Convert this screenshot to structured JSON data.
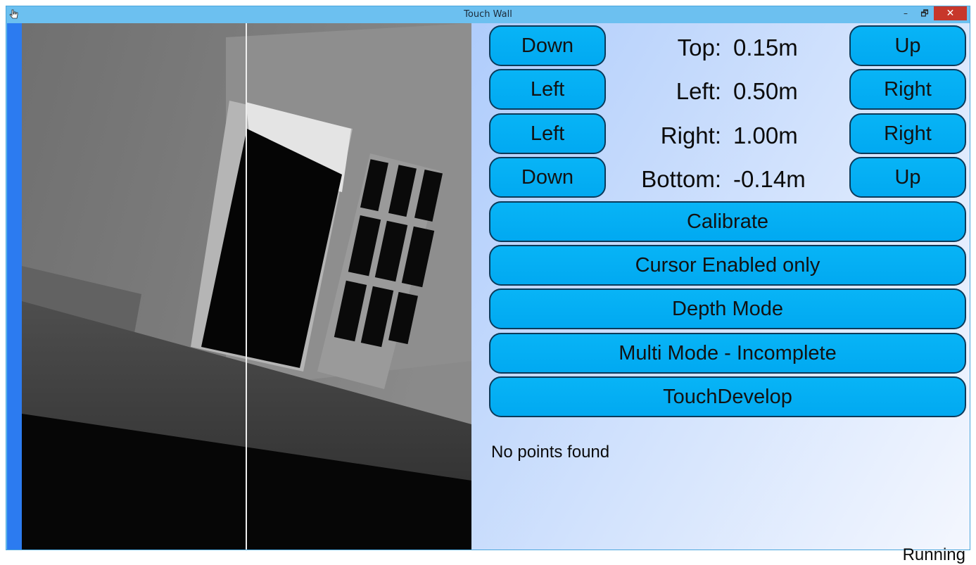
{
  "window": {
    "title": "Touch Wall",
    "controls": {
      "minimize": "–",
      "maximize": "🗗",
      "close": "✕"
    }
  },
  "boundaries": [
    {
      "name_label": "Top:",
      "value": "0.15m",
      "dec_label": "Down",
      "inc_label": "Up"
    },
    {
      "name_label": "Left:",
      "value": "0.50m",
      "dec_label": "Left",
      "inc_label": "Right"
    },
    {
      "name_label": "Right:",
      "value": "1.00m",
      "dec_label": "Left",
      "inc_label": "Right"
    },
    {
      "name_label": "Bottom:",
      "value": "-0.14m",
      "dec_label": "Down",
      "inc_label": "Up"
    }
  ],
  "actions": {
    "calibrate": "Calibrate",
    "cursor_enabled": "Cursor Enabled only",
    "depth_mode": "Depth Mode",
    "multi_mode": "Multi Mode - Incomplete",
    "touch_develop": "TouchDevelop"
  },
  "status_text": "No points found",
  "run_state": "Running",
  "colors": {
    "titlebar": "#6cc0f0",
    "close_button": "#c7372b",
    "button_fill": "#04aff4",
    "button_border": "#0b3a5a",
    "left_accent": "#2c7bf0"
  }
}
